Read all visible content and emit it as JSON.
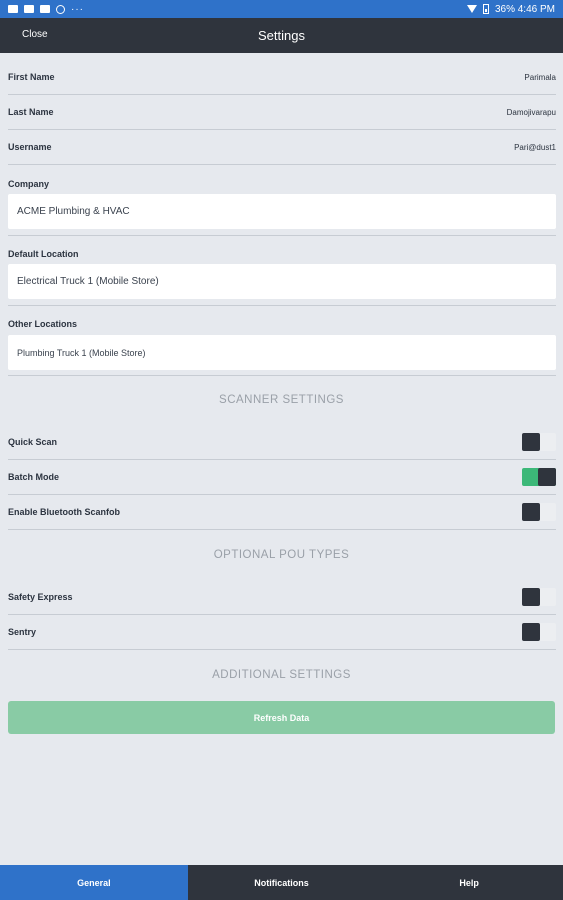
{
  "status_bar": {
    "right_text": "36% 4:46 PM",
    "left_icons": [
      "mail-icon",
      "gallery-icon",
      "video-icon",
      "at-icon",
      "more-icon"
    ]
  },
  "header": {
    "close_label": "Close",
    "title": "Settings"
  },
  "profile": [
    {
      "label": "First Name",
      "value": "Parimala"
    },
    {
      "label": "Last Name",
      "value": "Damojivarapu"
    },
    {
      "label": "Username",
      "value": "Pari@dust1"
    }
  ],
  "fields": {
    "company": {
      "label": "Company",
      "value": "ACME Plumbing & HVAC"
    },
    "default_location": {
      "label": "Default Location",
      "value": "Electrical Truck 1 (Mobile Store)"
    },
    "other_locations": {
      "label": "Other Locations",
      "value": "Plumbing Truck 1 (Mobile Store)"
    }
  },
  "scanner": {
    "heading": "SCANNER SETTINGS",
    "items": [
      {
        "label": "Quick Scan",
        "on": false
      },
      {
        "label": "Batch Mode",
        "on": true
      },
      {
        "label": "Enable Bluetooth Scanfob",
        "on": false
      }
    ]
  },
  "pou": {
    "heading": "OPTIONAL POU TYPES",
    "items": [
      {
        "label": "Safety Express",
        "on": false
      },
      {
        "label": "Sentry",
        "on": false
      }
    ]
  },
  "additional": {
    "heading": "ADDITIONAL SETTINGS",
    "refresh_label": "Refresh Data"
  },
  "tabs": [
    {
      "label": "General",
      "active": true
    },
    {
      "label": "Notifications",
      "active": false
    },
    {
      "label": "Help",
      "active": false
    }
  ],
  "colors": {
    "accent_blue": "#2f72c9",
    "dark": "#2f343d",
    "toggle_on": "#3cb878",
    "refresh_btn": "#89cba5"
  }
}
